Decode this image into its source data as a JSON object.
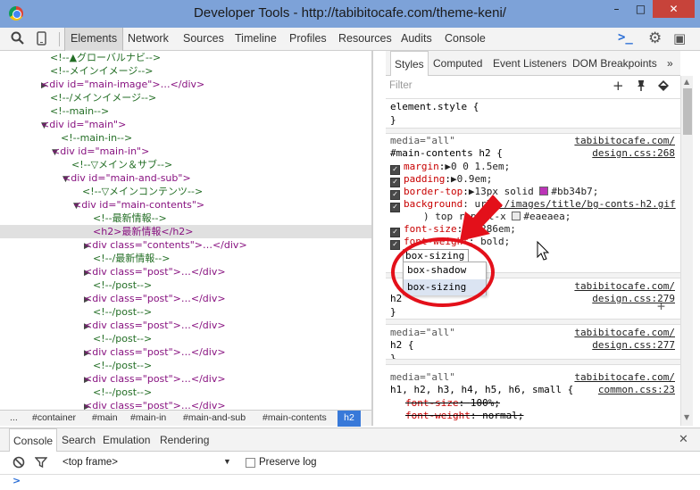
{
  "window": {
    "title": "Developer Tools - http://tabibitocafe.com/theme-keni/",
    "minimize": "–",
    "maximize": "□",
    "close": "✕"
  },
  "toolbar": {
    "search_icon": "search-icon",
    "device_icon": "mobile-device-icon",
    "tabs": [
      "Elements",
      "Network",
      "Sources",
      "Timeline",
      "Profiles",
      "Resources",
      "Audits",
      "Console"
    ],
    "active_tab": "Elements",
    "drawer_icon": ">_",
    "settings_icon": "⚙",
    "dock_icon": "▣"
  },
  "elements": {
    "lines": [
      {
        "t": "<!--▲グローバルナビ-->",
        "k": "comment"
      },
      {
        "t": "<!--メインイメージ-->",
        "k": "comment"
      },
      {
        "t": "<div id=\"main-image\">…</div>",
        "k": "tag"
      },
      {
        "t": "<!--/メインイメージ-->",
        "k": "comment"
      },
      {
        "t": "<!--main-->",
        "k": "comment"
      },
      {
        "t": "<div id=\"main\">",
        "k": "tag"
      },
      {
        "t": "<!--main-in-->",
        "k": "comment"
      },
      {
        "t": "<div id=\"main-in\">",
        "k": "tag"
      },
      {
        "t": "<!--▽メイン＆サブ-->",
        "k": "comment"
      },
      {
        "t": "<div id=\"main-and-sub\">",
        "k": "tag"
      },
      {
        "t": "<!--▽メインコンテンツ-->",
        "k": "comment"
      },
      {
        "t": "<div id=\"main-contents\">",
        "k": "tag"
      },
      {
        "t": "<!--最新情報-->",
        "k": "comment"
      },
      {
        "t": "<h2>最新情報</h2>",
        "k": "tag"
      },
      {
        "t": "<div class=\"contents\">…</div>",
        "k": "tag"
      },
      {
        "t": "<!--/最新情報-->",
        "k": "comment"
      },
      {
        "t": "<div class=\"post\">…</div>",
        "k": "tag"
      },
      {
        "t": "<!--/post-->",
        "k": "comment"
      },
      {
        "t": "<div class=\"post\">…</div>",
        "k": "tag"
      },
      {
        "t": "<!--/post-->",
        "k": "comment"
      },
      {
        "t": "<div class=\"post\">…</div>",
        "k": "tag"
      },
      {
        "t": "<!--/post-->",
        "k": "comment"
      },
      {
        "t": "<div class=\"post\">…</div>",
        "k": "tag"
      },
      {
        "t": "<!--/post-->",
        "k": "comment"
      },
      {
        "t": "<div class=\"post\">…</div>",
        "k": "tag"
      },
      {
        "t": "<!--/post-->",
        "k": "comment"
      },
      {
        "t": "<div class=\"post\">…</div>",
        "k": "tag"
      }
    ],
    "breadcrumb": [
      "...",
      "#container",
      "#main",
      "#main-in",
      "#main-and-sub",
      "#main-contents",
      "h2"
    ]
  },
  "styles": {
    "tabs": [
      "Styles",
      "Computed",
      "Event Listeners",
      "DOM Breakpoints",
      "»"
    ],
    "active_tab": "Styles",
    "filter_placeholder": "Filter",
    "element_style": {
      "selector": "element.style {",
      "close": "}"
    },
    "rule1": {
      "media": "media=\"all\"",
      "source1": "tabibitocafe.com/",
      "source2": "design.css:268",
      "selector": "#main-contents h2 {",
      "props": [
        {
          "name": "margin",
          "val": "▶0 0 1.5em;"
        },
        {
          "name": "padding",
          "val": "▶0.9em;"
        },
        {
          "name": "border-top",
          "val": "▶13px solid ",
          "color": "#bb34b7",
          "val2": "#bb34b7;"
        },
        {
          "name": "background",
          "val": ": url(",
          "link": "./images/title/bg-conts-h2.gif",
          "val2": ") top repeat-x ",
          "color2": "#eaeaea",
          "val3": "#eaeaea;"
        },
        {
          "name": "font-size",
          "val": "1.286em;"
        },
        {
          "name": "font-weight",
          "val": "bold;"
        }
      ],
      "typing": "box-sizing",
      "suggestions": [
        "box-shadow",
        "box-sizing"
      ]
    },
    "rule2": {
      "media": "media=\"all\"",
      "source1": "tabibitocafe.com/",
      "source2": "design.css:279",
      "selector": "h2",
      "close": "}"
    },
    "rule3": {
      "media": "media=\"all\"",
      "source1": "tabibitocafe.com/",
      "source2": "design.css:277",
      "selector": "h2 {",
      "close": "}"
    },
    "rule4": {
      "media": "media=\"all\"",
      "source1": "tabibitocafe.com/",
      "source2": "common.css:23",
      "selector": "h1, h2, h3, h4, h5, h6, small {",
      "props": [
        {
          "name": "font-size",
          "val": "100%;"
        },
        {
          "name": "font-weight",
          "val": "normal;"
        }
      ]
    }
  },
  "console": {
    "tabs": [
      "Console",
      "Search",
      "Emulation",
      "Rendering"
    ],
    "active_tab": "Console",
    "frame": "<top frame>",
    "preserve_log": "Preserve log",
    "prompt": ">"
  },
  "colors": {
    "titlebar": "#7da2d8",
    "close": "#c7433a",
    "breadcrumb_active": "#3879d9",
    "annotation": "#e3101a"
  }
}
